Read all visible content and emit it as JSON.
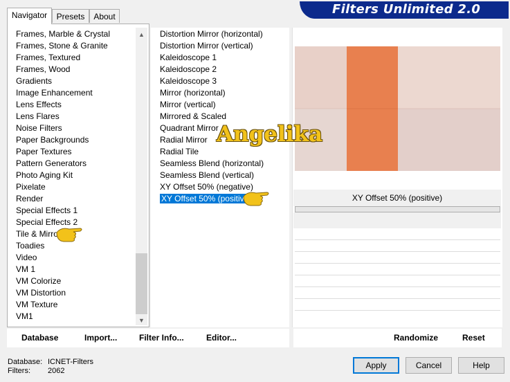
{
  "window": {
    "title": "Filters Unlimited 2.0",
    "accent": "#0c2a8c"
  },
  "tabs": [
    {
      "label": "Navigator",
      "active": true
    },
    {
      "label": "Presets",
      "active": false
    },
    {
      "label": "About",
      "active": false
    }
  ],
  "categories": [
    "Frames, Marble & Crystal",
    "Frames, Stone & Granite",
    "Frames, Textured",
    "Frames, Wood",
    "Gradients",
    "Image Enhancement",
    "Lens Effects",
    "Lens Flares",
    "Noise Filters",
    "Paper Backgrounds",
    "Paper Textures",
    "Pattern Generators",
    "Photo Aging Kit",
    "Pixelate",
    "Render",
    "Special Effects 1",
    "Special Effects 2",
    "Tile & Mirror",
    "Toadies",
    "Video",
    "VM 1",
    "VM Colorize",
    "VM Distortion",
    "VM Texture",
    "VM1"
  ],
  "selected_category": "Tile & Mirror",
  "effects": [
    "Distortion Mirror (horizontal)",
    "Distortion Mirror (vertical)",
    "Kaleidoscope 1",
    "Kaleidoscope 2",
    "Kaleidoscope 3",
    "Mirror (horizontal)",
    "Mirror (vertical)",
    "Mirrored & Scaled",
    "Quadrant Mirror",
    "Radial Mirror",
    "Radial Tile",
    "Seamless Blend (horizontal)",
    "Seamless Blend (vertical)",
    "XY Offset 50% (negative)",
    "XY Offset 50% (positive)"
  ],
  "selected_effect": "XY Offset 50% (positive)",
  "preview": {
    "filter_label": "XY Offset 50% (positive)",
    "watermark": "Angelika",
    "accent": "#e8804f"
  },
  "toolbar": {
    "database": "Database",
    "import": "Import...",
    "filter_info": "Filter Info...",
    "editor": "Editor...",
    "randomize": "Randomize",
    "reset": "Reset"
  },
  "status": {
    "database_label": "Database:",
    "database_value": "ICNET-Filters",
    "filters_label": "Filters:",
    "filters_value": "2062"
  },
  "buttons": {
    "apply": "Apply",
    "cancel": "Cancel",
    "help": "Help"
  },
  "scroll_arrows": {
    "up": "▲",
    "down": "▼"
  }
}
